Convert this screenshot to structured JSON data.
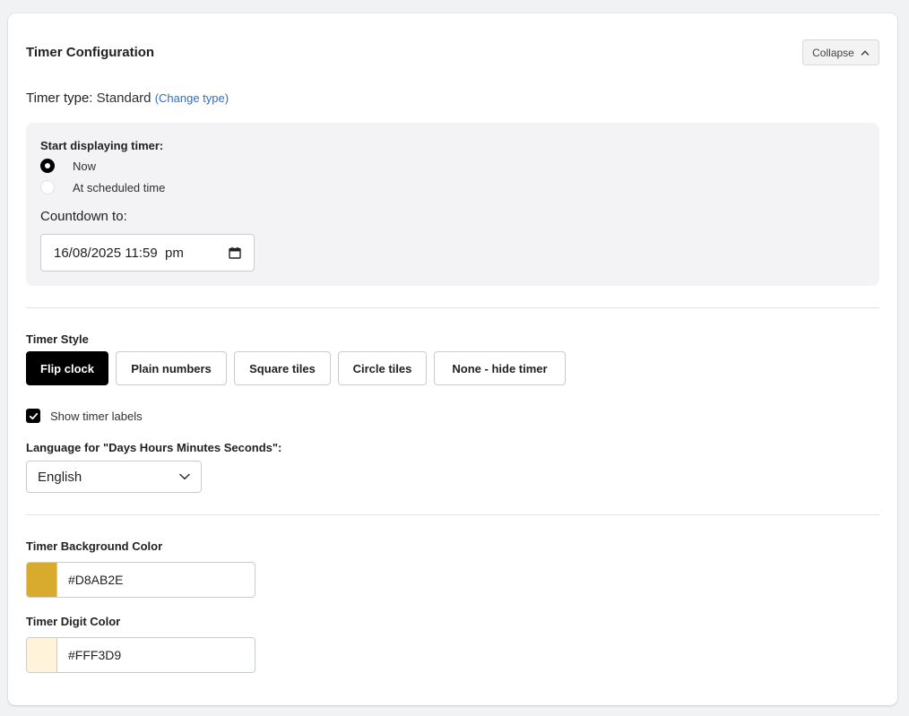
{
  "card": {
    "title": "Timer Configuration",
    "collapse_label": "Collapse"
  },
  "timer_type": {
    "label": "Timer type:",
    "value": "Standard",
    "change_link": "(Change type)"
  },
  "schedule": {
    "start_label": "Start displaying timer:",
    "options": [
      {
        "label": "Now",
        "selected": true
      },
      {
        "label": "At scheduled time",
        "selected": false
      }
    ],
    "countdown_label": "Countdown to:",
    "countdown_value": "16/08/2025 11:59  pm"
  },
  "timer_style": {
    "label": "Timer Style",
    "options": [
      "Flip clock",
      "Plain numbers",
      "Square tiles",
      "Circle tiles",
      "None - hide timer"
    ],
    "selected": "Flip clock"
  },
  "show_labels": {
    "label": "Show timer labels",
    "checked": true
  },
  "language": {
    "label": "Language for \"Days Hours Minutes Seconds\":",
    "value": "English"
  },
  "colors": {
    "background": {
      "label": "Timer Background Color",
      "value": "#D8AB2E",
      "swatch": "#D8AB2E"
    },
    "digit": {
      "label": "Timer Digit Color",
      "value": "#FFF3D9",
      "swatch": "#FFF3D9"
    }
  },
  "icons": {
    "collapse": "chevron-up-icon",
    "calendar": "calendar-icon",
    "select": "chevron-down-icon",
    "checkbox": "checkmark-icon"
  }
}
